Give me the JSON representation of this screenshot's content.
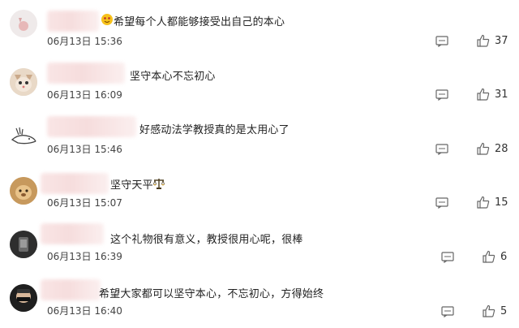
{
  "comments": [
    {
      "text": "希望每个人都能够接受出自己的本心",
      "time": "06月13日 15:36",
      "likes": "37"
    },
    {
      "text": "坚守本心不忘初心",
      "time": "06月13日 16:09",
      "likes": "31"
    },
    {
      "text": "好感动法学教授真的是太用心了",
      "time": "06月13日 15:46",
      "likes": "28"
    },
    {
      "text": "坚守天平",
      "time": "06月13日 15:07",
      "likes": "15"
    },
    {
      "text": "这个礼物很有意义，教授很用心呢，很棒",
      "time": "06月13日 16:39",
      "likes": "6"
    },
    {
      "text": "希望大家都可以坚守本心，不忘初心，方得始终",
      "time": "06月13日 16:40",
      "likes": "5"
    }
  ],
  "icons": {
    "comment": "comment-icon",
    "like": "thumbs-up-icon"
  },
  "colors": {
    "name_blur": "#f7dede",
    "icon": "#666666"
  }
}
